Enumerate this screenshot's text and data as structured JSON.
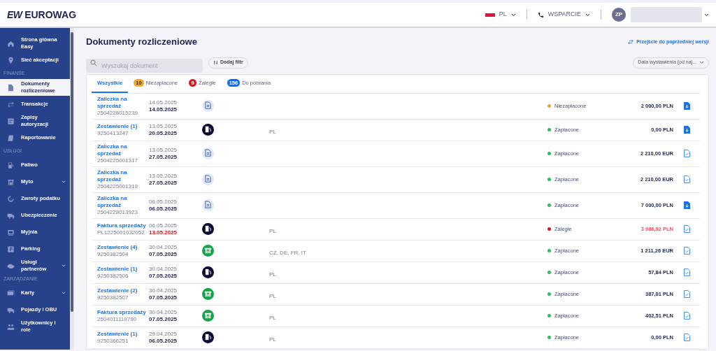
{
  "header": {
    "logo_mark": "EW",
    "logo_text": "EUROWAG",
    "language": "PL",
    "support": "WSPARCIE",
    "avatar": "ZP"
  },
  "sidebar": [
    {
      "kind": "item",
      "label": "Strona główna Easy",
      "selected": false,
      "expandable": false
    },
    {
      "kind": "item",
      "label": "Sieć akceptacji",
      "selected": false,
      "expandable": false
    },
    {
      "kind": "section",
      "label": "FINANSE"
    },
    {
      "kind": "item",
      "label": "Dokumenty rozliczeniowe",
      "selected": true,
      "expandable": false
    },
    {
      "kind": "item",
      "label": "Transakcje",
      "selected": false,
      "expandable": false
    },
    {
      "kind": "item",
      "label": "Zapisy autoryzacji",
      "selected": false,
      "expandable": false
    },
    {
      "kind": "item",
      "label": "Raportowanie",
      "selected": false,
      "expandable": false
    },
    {
      "kind": "section",
      "label": "USŁUGI"
    },
    {
      "kind": "item",
      "label": "Paliwo",
      "selected": false,
      "expandable": false
    },
    {
      "kind": "item",
      "label": "Myto",
      "selected": false,
      "expandable": true
    },
    {
      "kind": "item",
      "label": "Zwroty podatku",
      "selected": false,
      "expandable": false
    },
    {
      "kind": "item",
      "label": "Ubezpieczenie",
      "selected": false,
      "expandable": false
    },
    {
      "kind": "item",
      "label": "Myjnia",
      "selected": false,
      "expandable": false
    },
    {
      "kind": "item",
      "label": "Parking",
      "selected": false,
      "expandable": false
    },
    {
      "kind": "item",
      "label": "Usługi partnerów",
      "selected": false,
      "expandable": true
    },
    {
      "kind": "section",
      "label": "ZARZĄDZANIE"
    },
    {
      "kind": "item",
      "label": "Karty",
      "selected": false,
      "expandable": true
    },
    {
      "kind": "item",
      "label": "Pojazdy i OBU",
      "selected": false,
      "expandable": false
    },
    {
      "kind": "item",
      "label": "Użytkownicy i role",
      "selected": false,
      "expandable": false
    }
  ],
  "page": {
    "title": "Dokumenty rozliczeniowe",
    "previous_version_link": "Przejście do poprzedniej wersji",
    "search": {
      "placeholder": "Wyszukaj dokument"
    },
    "add_filter": "Dodaj filtr",
    "sort": "Data wystawienia (od naj..."
  },
  "tabs": [
    {
      "label": "Wszystkie",
      "selected": true
    },
    {
      "label": "Niezapłacone",
      "count": "10",
      "color": "#f5a623",
      "selected": false
    },
    {
      "label": "Zaległe",
      "count": "9",
      "color": "#e0141e",
      "selected": false
    },
    {
      "label": "Do pobrania",
      "count": "156",
      "color": "#0a6cff",
      "selected": false
    }
  ],
  "rows": [
    {
      "name": "Zaliczka na sprzedaż",
      "number": "2504228015239",
      "issued": "14.05.2025",
      "due": "14.05.2025",
      "kind": "document",
      "countries": "",
      "color": "#f5a623",
      "overdue": false,
      "status_label": "Niezapłacone",
      "amount": "2 000,00 PLN",
      "downloaded": false
    },
    {
      "name": "Zestawienie (1)",
      "number": "9250413247",
      "issued": "13.05.2025",
      "due": "20.05.2025",
      "kind": "fuel",
      "countries": "PL",
      "color": "#22c55e",
      "overdue": false,
      "status_label": "Zapłacone",
      "amount": "0,00 PLN",
      "downloaded": false
    },
    {
      "name": "Zaliczka na sprzedaż",
      "number": "2504225001317",
      "issued": "13.05.2025",
      "due": "27.05.2025",
      "kind": "document",
      "countries": "",
      "color": "#22c55e",
      "overdue": false,
      "status_label": "Zapłacone",
      "amount": "2 210,00 EUR",
      "downloaded": true
    },
    {
      "name": "Zaliczka na sprzedaż",
      "number": "2504225001319",
      "issued": "13.05.2025",
      "due": "27.05.2025",
      "kind": "document",
      "countries": "",
      "color": "#22c55e",
      "overdue": false,
      "status_label": "Zapłacone",
      "amount": "2 210,00 EUR",
      "downloaded": true
    },
    {
      "name": "Zaliczka na sprzedaż",
      "number": "2504228013923",
      "issued": "06.05.2025",
      "due": "06.05.2025",
      "kind": "document",
      "countries": "",
      "color": "#22c55e",
      "overdue": false,
      "status_label": "Zapłacone",
      "amount": "7 000,00 PLN",
      "downloaded": false
    },
    {
      "name": "Faktura sprzedaży",
      "number": "PL1225001032052",
      "issued": "06.05.2025",
      "due": "13.05.2025",
      "kind": "fuel",
      "countries": "PL",
      "color": "#e0141e",
      "overdue": true,
      "status_label": "Zaległe",
      "amount": "3 986,92 PLN",
      "downloaded": true
    },
    {
      "name": "Zestawienie (4)",
      "number": "9250382504",
      "issued": "30.04.2025",
      "due": "07.05.2025",
      "kind": "toll",
      "countries": "CZ, DE, FR, IT",
      "color": "#22c55e",
      "overdue": false,
      "status_label": "Zapłacone",
      "amount": "1 211,26 EUR",
      "downloaded": true
    },
    {
      "name": "Zestawienie (1)",
      "number": "9250382506",
      "issued": "30.04.2025",
      "due": "07.05.2025",
      "kind": "fuel",
      "countries": "PL",
      "color": "#22c55e",
      "overdue": false,
      "status_label": "Zapłacone",
      "amount": "57,84 PLN",
      "downloaded": true
    },
    {
      "name": "Zestawienie (2)",
      "number": "9250382507",
      "issued": "30.04.2025",
      "due": "07.05.2025",
      "kind": "toll",
      "countries": "PL",
      "color": "#22c55e",
      "overdue": false,
      "status_label": "Zapłacone",
      "amount": "387,01 PLN",
      "downloaded": true
    },
    {
      "name": "Faktura sprzedaży",
      "number": "2504011119790",
      "issued": "30.04.2025",
      "due": "07.05.2025",
      "kind": "toll",
      "countries": "PL",
      "color": "#22c55e",
      "overdue": false,
      "status_label": "Zapłacone",
      "amount": "402,51 PLN",
      "downloaded": true
    },
    {
      "name": "Zestawienie (1)",
      "number": "9250366251",
      "issued": "29.04.2025",
      "due": "06.05.2025",
      "kind": "fuel",
      "countries": "PL",
      "color": "#22c55e",
      "overdue": false,
      "status_label": "Zapłacone",
      "amount": "0,00 PLN",
      "downloaded": true
    }
  ]
}
